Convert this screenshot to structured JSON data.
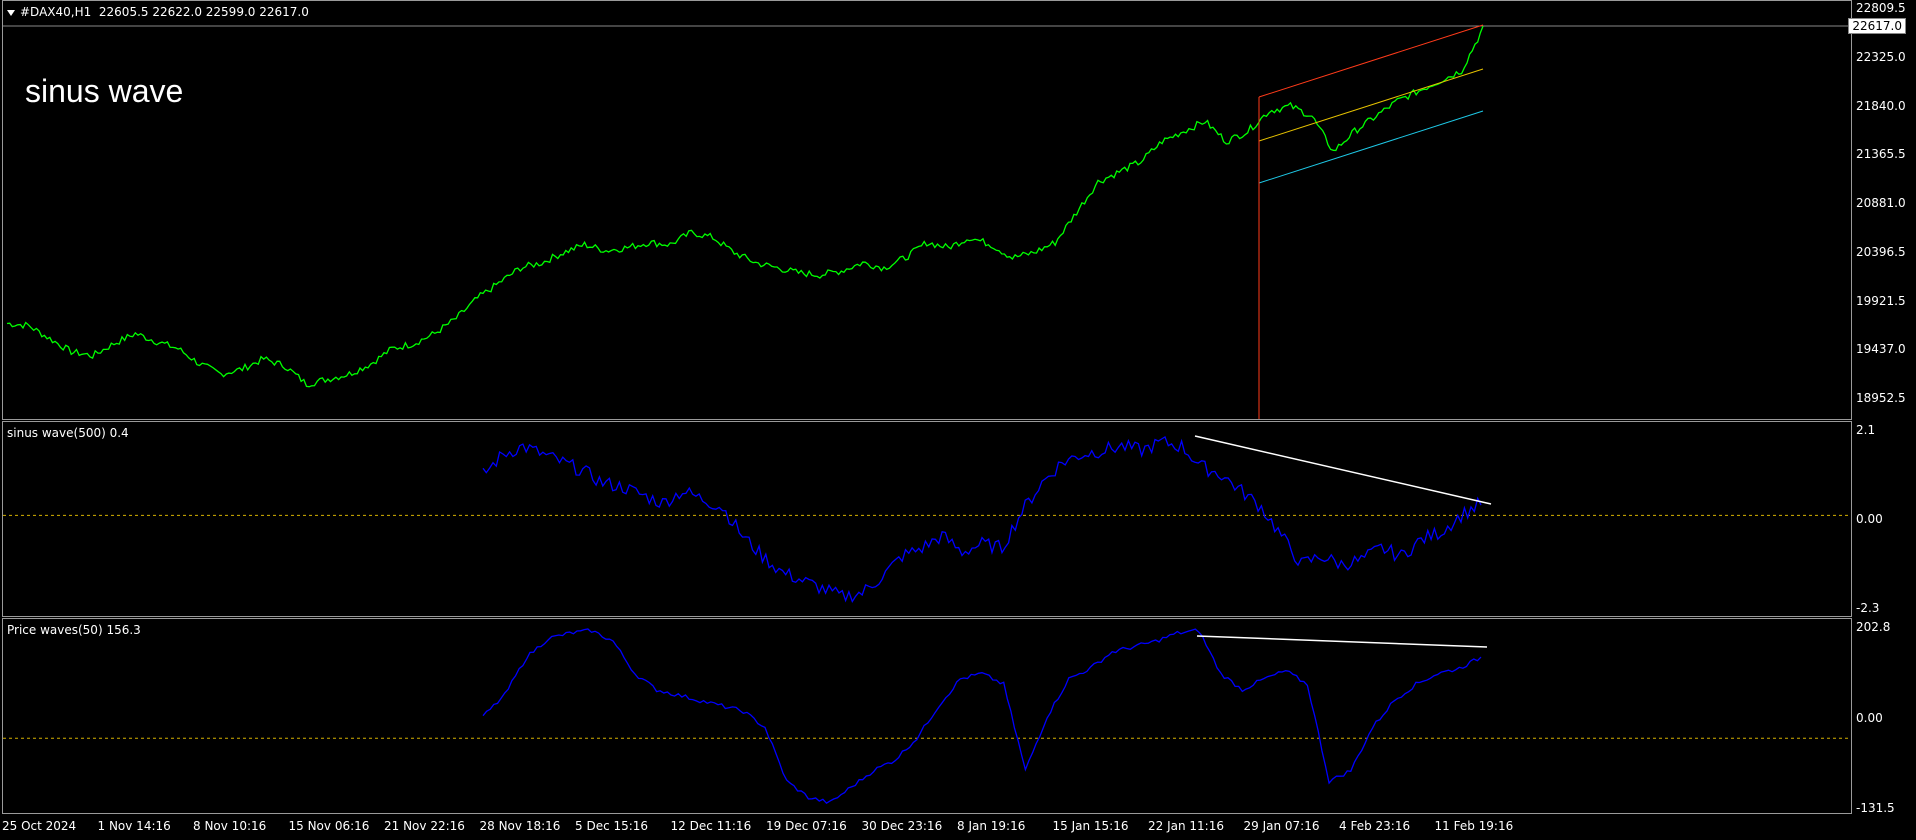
{
  "main": {
    "symbol": "#DAX40,H1",
    "ohlc": "22605.5 22622.0 22599.0 22617.0",
    "annotation": "sinus wave",
    "current_price": "22617.0",
    "price_ticks": [
      "22809.5",
      "22325.0",
      "21840.0",
      "21365.5",
      "20881.0",
      "20396.5",
      "19921.5",
      "19437.0",
      "18952.5"
    ],
    "line_color": "#00ff00"
  },
  "ind1": {
    "title": "sinus wave(500) 0.4",
    "ticks": [
      "2.1",
      "0.00",
      "-2.3"
    ],
    "line_color": "#0000ff"
  },
  "ind2": {
    "title": "Price waves(50) 156.3",
    "ticks": [
      "202.8",
      "0.00",
      "-131.5"
    ],
    "line_color": "#0000ff"
  },
  "time_labels": [
    "25 Oct 2024",
    "1 Nov 14:16",
    "8 Nov 10:16",
    "15 Nov 06:16",
    "21 Nov 22:16",
    "28 Nov 18:16",
    "5 Dec 15:16",
    "12 Dec 11:16",
    "19 Dec 07:16",
    "30 Dec 23:16",
    "8 Jan 19:16",
    "15 Jan 15:16",
    "22 Jan 11:16",
    "29 Jan 07:16",
    "4 Feb 23:16",
    "11 Feb 19:16"
  ],
  "chart_data": [
    {
      "type": "line",
      "title": "#DAX40,H1",
      "ylim": [
        18952.5,
        22809.5
      ],
      "series": [
        {
          "name": "#DAX40,H1",
          "values": [
            19700,
            19680,
            19550,
            19420,
            19380,
            19500,
            19600,
            19520,
            19450,
            19300,
            19200,
            19250,
            19350,
            19280,
            19100,
            19150,
            19200,
            19300,
            19450,
            19500,
            19600,
            19750,
            19950,
            20100,
            20250,
            20300,
            20400,
            20480,
            20420,
            20450,
            20500,
            20480,
            20600,
            20550,
            20400,
            20300,
            20250,
            20200,
            20180,
            20220,
            20300,
            20250,
            20350,
            20500,
            20450,
            20550,
            20480,
            20350,
            20400,
            20500,
            20800,
            21100,
            21200,
            21300,
            21500,
            21600,
            21700,
            21500,
            21600,
            21800,
            21850,
            21750,
            21400,
            21600,
            21750,
            21900,
            22000,
            22100,
            22200,
            22617
          ]
        }
      ]
    },
    {
      "type": "line",
      "title": "sinus wave(500) 0.4",
      "ylim": [
        -2.3,
        2.1
      ],
      "series": [
        {
          "name": "sinus wave(500)",
          "values": [
            1.0,
            1.5,
            1.7,
            1.5,
            1.3,
            1.1,
            0.8,
            0.7,
            0.5,
            0.3,
            0.6,
            0.4,
            0.2,
            -0.5,
            -1.0,
            -1.4,
            -1.6,
            -1.8,
            -2.0,
            -1.9,
            -1.5,
            -1.0,
            -0.8,
            -0.5,
            -0.9,
            -0.7,
            -0.8,
            0.1,
            0.8,
            1.3,
            1.5,
            1.6,
            1.7,
            1.6,
            1.8,
            1.7,
            1.2,
            1.0,
            0.6,
            0.2,
            -0.5,
            -1.2,
            -1.0,
            -1.2,
            -1.1,
            -0.8,
            -1.0,
            -0.6,
            -0.4,
            0.0,
            0.3
          ]
        }
      ]
    },
    {
      "type": "line",
      "title": "Price waves(50) 156.3",
      "ylim": [
        -131.5,
        202.8
      ],
      "series": [
        {
          "name": "Price waves(50)",
          "values": [
            40,
            80,
            150,
            185,
            195,
            200,
            180,
            120,
            90,
            80,
            70,
            60,
            50,
            20,
            -80,
            -110,
            -120,
            -90,
            -60,
            -40,
            0,
            60,
            110,
            120,
            100,
            -60,
            40,
            110,
            130,
            160,
            170,
            180,
            195,
            200,
            120,
            90,
            110,
            125,
            100,
            -80,
            -60,
            20,
            70,
            100,
            120,
            130,
            150
          ]
        }
      ]
    }
  ]
}
